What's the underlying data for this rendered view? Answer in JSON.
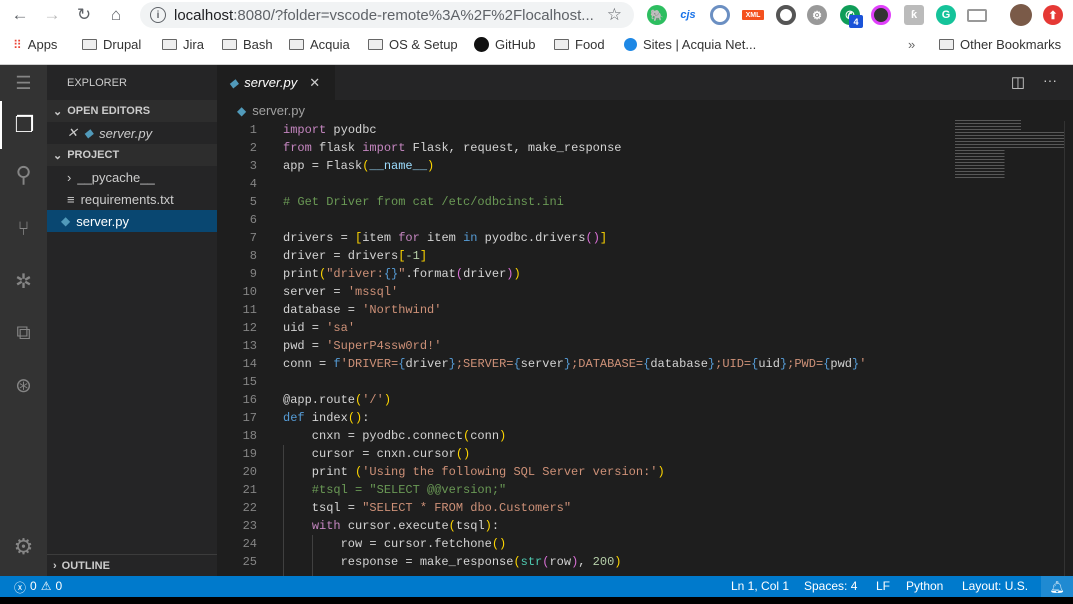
{
  "browser": {
    "url_host": "localhost",
    "url_rest": ":8080/?folder=vscode-remote%3A%2F%2Flocalhost...",
    "extension_badge": "4",
    "extensions": [
      "evernote-icon",
      "cjs-icon",
      "ext-icon",
      "xml-icon",
      "ext-icon",
      "gear-icon",
      "phone-icon",
      "camera-icon",
      "k-icon",
      "grammarly-icon",
      "cast-icon",
      "avatar",
      "upload-icon"
    ],
    "cjs_label": "cjs",
    "xml_label": "XML",
    "bookmarks": [
      {
        "label": "Apps",
        "icon": "apps-grid-icon"
      },
      {
        "label": "Drupal",
        "icon": "folder-icon"
      },
      {
        "label": "Jira",
        "icon": "folder-icon"
      },
      {
        "label": "Bash",
        "icon": "folder-icon"
      },
      {
        "label": "Acquia",
        "icon": "folder-icon"
      },
      {
        "label": "OS & Setup",
        "icon": "folder-icon"
      },
      {
        "label": "GitHub",
        "icon": "github-icon"
      },
      {
        "label": "Food",
        "icon": "folder-icon"
      },
      {
        "label": "Sites | Acquia Net...",
        "icon": "drop-icon"
      }
    ],
    "more_bookmarks": "»",
    "other_bookmarks": "Other Bookmarks"
  },
  "sidebar": {
    "title": "EXPLORER",
    "open_editors": "OPEN EDITORS",
    "open_file": "server.py",
    "project": "PROJECT",
    "files": [
      "__pycache__",
      "requirements.txt",
      "server.py"
    ],
    "outline": "OUTLINE"
  },
  "editor": {
    "tab": "server.py",
    "breadcrumb": "server.py",
    "lines": [
      [
        [
          "import",
          "k"
        ],
        [
          " pyodbc",
          "t"
        ]
      ],
      [
        [
          "from",
          "k"
        ],
        [
          " flask ",
          "t"
        ],
        [
          "import",
          "k"
        ],
        [
          " Flask, request, make_response",
          "t"
        ]
      ],
      [
        [
          "app = Flask",
          "t"
        ],
        [
          "(",
          "y"
        ],
        [
          "__name__",
          "v"
        ],
        [
          ")",
          "y"
        ]
      ],
      [],
      [
        [
          "# Get Driver from cat /etc/odbcinst.ini",
          "c"
        ]
      ],
      [],
      [
        [
          "drivers = ",
          "t"
        ],
        [
          "[",
          "y"
        ],
        [
          "item ",
          "t"
        ],
        [
          "for",
          "k"
        ],
        [
          " item ",
          "t"
        ],
        [
          "in",
          "b"
        ],
        [
          " pyodbc.drivers",
          "t"
        ],
        [
          "()",
          "p"
        ],
        [
          "]",
          "y"
        ]
      ],
      [
        [
          "driver = drivers",
          "t"
        ],
        [
          "[",
          "y"
        ],
        [
          "-1",
          "n"
        ],
        [
          "]",
          "y"
        ]
      ],
      [
        [
          "print",
          "t"
        ],
        [
          "(",
          "y"
        ],
        [
          "\"driver:",
          "s"
        ],
        [
          "{}",
          "b"
        ],
        [
          "\"",
          "s"
        ],
        [
          ".format",
          "t"
        ],
        [
          "(",
          "p"
        ],
        [
          "driver",
          "t"
        ],
        [
          ")",
          "p"
        ],
        [
          ")",
          "y"
        ]
      ],
      [
        [
          "server = ",
          "t"
        ],
        [
          "'mssql'",
          "s"
        ]
      ],
      [
        [
          "database = ",
          "t"
        ],
        [
          "'Northwind'",
          "s"
        ]
      ],
      [
        [
          "uid = ",
          "t"
        ],
        [
          "'sa'",
          "s"
        ]
      ],
      [
        [
          "pwd = ",
          "t"
        ],
        [
          "'SuperP4ssw0rd!'",
          "s"
        ]
      ],
      [
        [
          "conn = ",
          "t"
        ],
        [
          "f",
          "b"
        ],
        [
          "'DRIVER=",
          "s"
        ],
        [
          "{",
          "b"
        ],
        [
          "driver",
          "t"
        ],
        [
          "}",
          "b"
        ],
        [
          ";SERVER=",
          "s"
        ],
        [
          "{",
          "b"
        ],
        [
          "server",
          "t"
        ],
        [
          "}",
          "b"
        ],
        [
          ";DATABASE=",
          "s"
        ],
        [
          "{",
          "b"
        ],
        [
          "database",
          "t"
        ],
        [
          "}",
          "b"
        ],
        [
          ";UID=",
          "s"
        ],
        [
          "{",
          "b"
        ],
        [
          "uid",
          "t"
        ],
        [
          "}",
          "b"
        ],
        [
          ";PWD=",
          "s"
        ],
        [
          "{",
          "b"
        ],
        [
          "pwd",
          "t"
        ],
        [
          "}",
          "b"
        ],
        [
          "'",
          "s"
        ]
      ],
      [],
      [
        [
          "@app.route",
          "t"
        ],
        [
          "(",
          "y"
        ],
        [
          "'/'",
          "s"
        ],
        [
          ")",
          "y"
        ]
      ],
      [
        [
          "def",
          "b"
        ],
        [
          " index",
          "t"
        ],
        [
          "()",
          "y"
        ],
        [
          ":",
          "t"
        ]
      ],
      [
        [
          "    cnxn = pyodbc.connect",
          "t"
        ],
        [
          "(",
          "y"
        ],
        [
          "conn",
          "t"
        ],
        [
          ")",
          "y"
        ]
      ],
      [
        [
          "    cursor = cnxn.cursor",
          "t"
        ],
        [
          "()",
          "y"
        ]
      ],
      [
        [
          "    print ",
          "t"
        ],
        [
          "(",
          "y"
        ],
        [
          "'Using the following SQL Server version:'",
          "s"
        ],
        [
          ")",
          "y"
        ]
      ],
      [
        [
          "    #tsql = \"SELECT @@version;\"",
          "c"
        ]
      ],
      [
        [
          "    tsql = ",
          "t"
        ],
        [
          "\"SELECT * FROM dbo.Customers\"",
          "s"
        ]
      ],
      [
        [
          "    ",
          "t"
        ],
        [
          "with",
          "k"
        ],
        [
          " cursor.execute",
          "t"
        ],
        [
          "(",
          "y"
        ],
        [
          "tsql",
          "t"
        ],
        [
          ")",
          "y"
        ],
        [
          ":",
          "t"
        ]
      ],
      [
        [
          "        row = cursor.fetchone",
          "t"
        ],
        [
          "()",
          "y"
        ]
      ],
      [
        [
          "        response = make_response",
          "t"
        ],
        [
          "(",
          "y"
        ],
        [
          "str",
          "f"
        ],
        [
          "(",
          "p"
        ],
        [
          "row",
          "t"
        ],
        [
          ")",
          "p"
        ],
        [
          ", ",
          "t"
        ],
        [
          "200",
          "n"
        ],
        [
          ")",
          "y"
        ]
      ]
    ]
  },
  "status": {
    "errors": "0",
    "warnings": "0",
    "position": "Ln 1, Col 1",
    "spaces": "Spaces: 4",
    "eol": "LF",
    "language": "Python",
    "layout": "Layout: U.S."
  },
  "colors": {
    "accent": "#007acc",
    "sidebar_selected": "#094771"
  }
}
